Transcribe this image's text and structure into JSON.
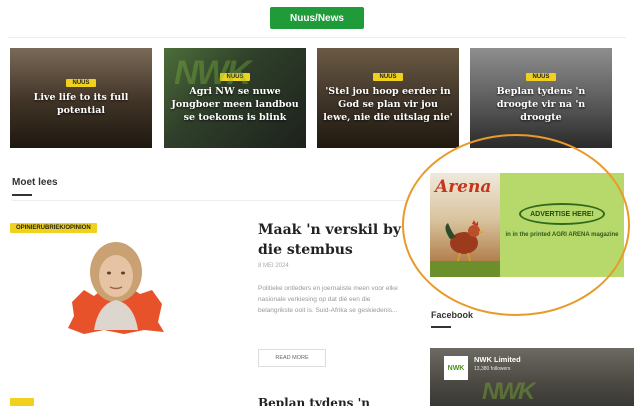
{
  "header": {
    "badge": "Nuus/News"
  },
  "cards": [
    {
      "tag": "NUUS",
      "headline": "Live life to its full potential"
    },
    {
      "tag": "NUUS",
      "headline": "Agri NW se nuwe Jongboer meen landbou se toekoms is blink"
    },
    {
      "tag": "NUUS",
      "headline": "'Stel jou hoop eerder in God se plan vir jou lewe, nie die uitslag nie'"
    },
    {
      "tag": "NUUS",
      "headline": "Beplan tydens 'n droogte vir na 'n droogte"
    }
  ],
  "must_read": {
    "title": "Moet lees",
    "opinion_tag": "OPINIERUBRIEK/OPINION",
    "article": {
      "title": "Maak 'n verskil by die stembus",
      "date": "8 MEI 2024",
      "excerpt": "Politieke ontleders en joernaliste meen voor elke nasionale verkiesing op dat dié een die belangrikste ooit is. Suid-Afrika se geskiedenis...",
      "read_more": "READ MORE"
    },
    "next_article_title": "Beplan tydens 'n droogte"
  },
  "ad": {
    "magazine_name": "Arena",
    "headline": "ADVERTISE HERE!",
    "sub": "in in the printed AGRI ARENA magazine"
  },
  "facebook": {
    "title": "Facebook",
    "page_name": "NWK Limited",
    "followers": "13,380 followers",
    "logo_text": "NWK",
    "watermark": "NWK"
  },
  "colors": {
    "accent_green": "#1f9b3a",
    "tag_yellow": "#f0d21e",
    "highlight_orange": "#e89a2a"
  }
}
